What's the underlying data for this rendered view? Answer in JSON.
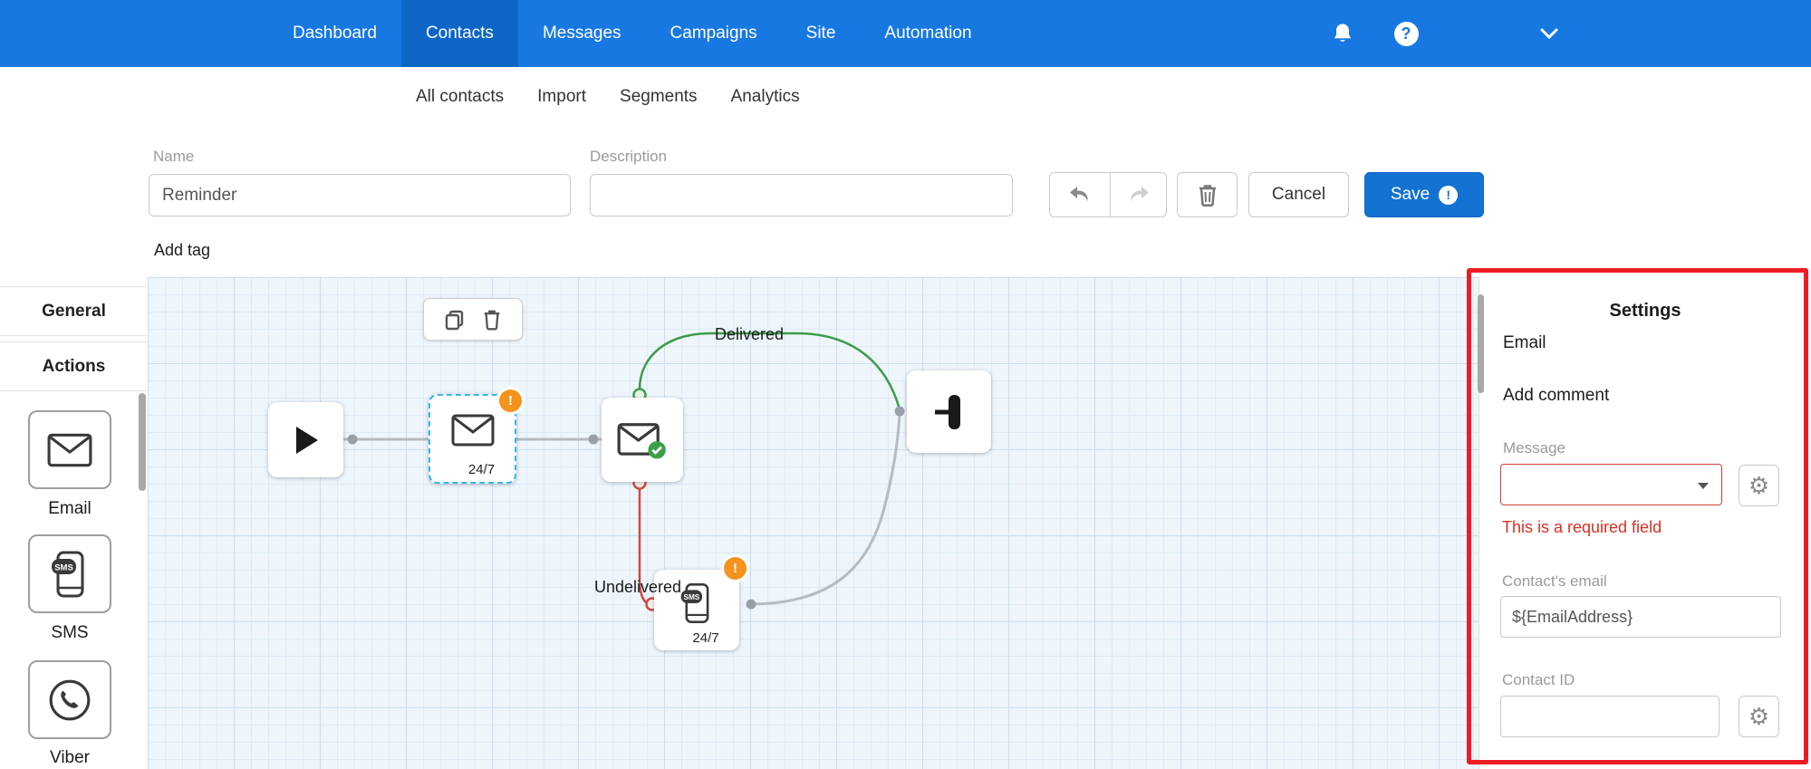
{
  "topnav": {
    "items": [
      "Dashboard",
      "Contacts",
      "Messages",
      "Campaigns",
      "Site",
      "Automation"
    ]
  },
  "subnav": {
    "items": [
      "All contacts",
      "Import",
      "Segments",
      "Analytics"
    ]
  },
  "toolbar": {
    "name_label": "Name",
    "name_value": "Reminder",
    "description_label": "Description",
    "description_value": "",
    "add_tag_label": "Add tag",
    "cancel_label": "Cancel",
    "save_label": "Save"
  },
  "sidebar": {
    "tabs": [
      "General",
      "Actions"
    ],
    "items": [
      "Email",
      "SMS",
      "Viber"
    ]
  },
  "canvas": {
    "delivered_label": "Delivered",
    "undelivered_label": "Undelivered",
    "email_node_badge": "24/7",
    "sms_node_badge": "24/7"
  },
  "settings": {
    "title": "Settings",
    "subtitle": "Email",
    "add_comment_label": "Add comment",
    "message_label": "Message",
    "message_value": "",
    "required_error": "This is a required field",
    "contact_email_label": "Contact's email",
    "contact_email_value": "${EmailAddress}",
    "contact_id_label": "Contact ID",
    "contact_id_value": ""
  },
  "icons": {
    "gear_glyph": "⚙",
    "warning_glyph": "!",
    "help_glyph": "?",
    "save_badge_glyph": "!"
  },
  "colors": {
    "header_blue": "#1878e2",
    "active_nav_blue": "#0d65c6",
    "save_blue": "#1472d2",
    "error_red": "#d93025",
    "annotation_red": "#ed1c24",
    "success_green": "#3d9c47",
    "undelivered_red": "#cd4c44",
    "warning_orange": "#f6921e",
    "canvas_blue": "#eef5fb",
    "selection_cyan": "#35b9e6"
  }
}
